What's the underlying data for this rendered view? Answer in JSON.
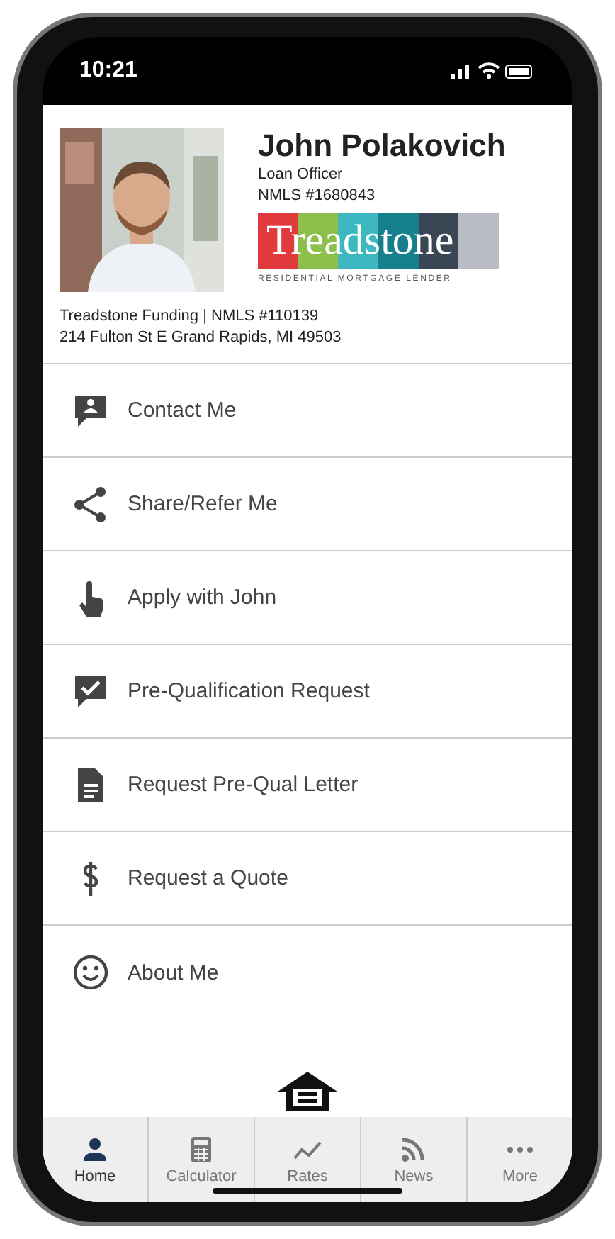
{
  "status_bar": {
    "time": "10:21"
  },
  "profile": {
    "name": "John Polakovich",
    "title": "Loan Officer",
    "nmls": "NMLS #1680843",
    "logo": {
      "wordmark": "Treadstone",
      "tagline": "RESIDENTIAL MORTGAGE LENDER"
    },
    "company": "Treadstone Funding | NMLS #110139",
    "address": "214 Fulton St E Grand Rapids, MI 49503"
  },
  "menu": [
    {
      "label": "Contact Me",
      "kind": "contact"
    },
    {
      "label": "Share/Refer Me",
      "kind": "share"
    },
    {
      "label": "Apply with John",
      "kind": "apply"
    },
    {
      "label": "Pre-Qualification Request",
      "kind": "prequal"
    },
    {
      "label": "Request Pre-Qual Letter",
      "kind": "letter"
    },
    {
      "label": "Request a Quote",
      "kind": "quote"
    },
    {
      "label": "About Me",
      "kind": "about"
    }
  ],
  "tabs": [
    {
      "label": "Home",
      "kind": "home",
      "selected": true
    },
    {
      "label": "Calculator",
      "kind": "calculator",
      "selected": false
    },
    {
      "label": "Rates",
      "kind": "rates",
      "selected": false
    },
    {
      "label": "News",
      "kind": "news",
      "selected": false
    },
    {
      "label": "More",
      "kind": "more",
      "selected": false
    }
  ]
}
